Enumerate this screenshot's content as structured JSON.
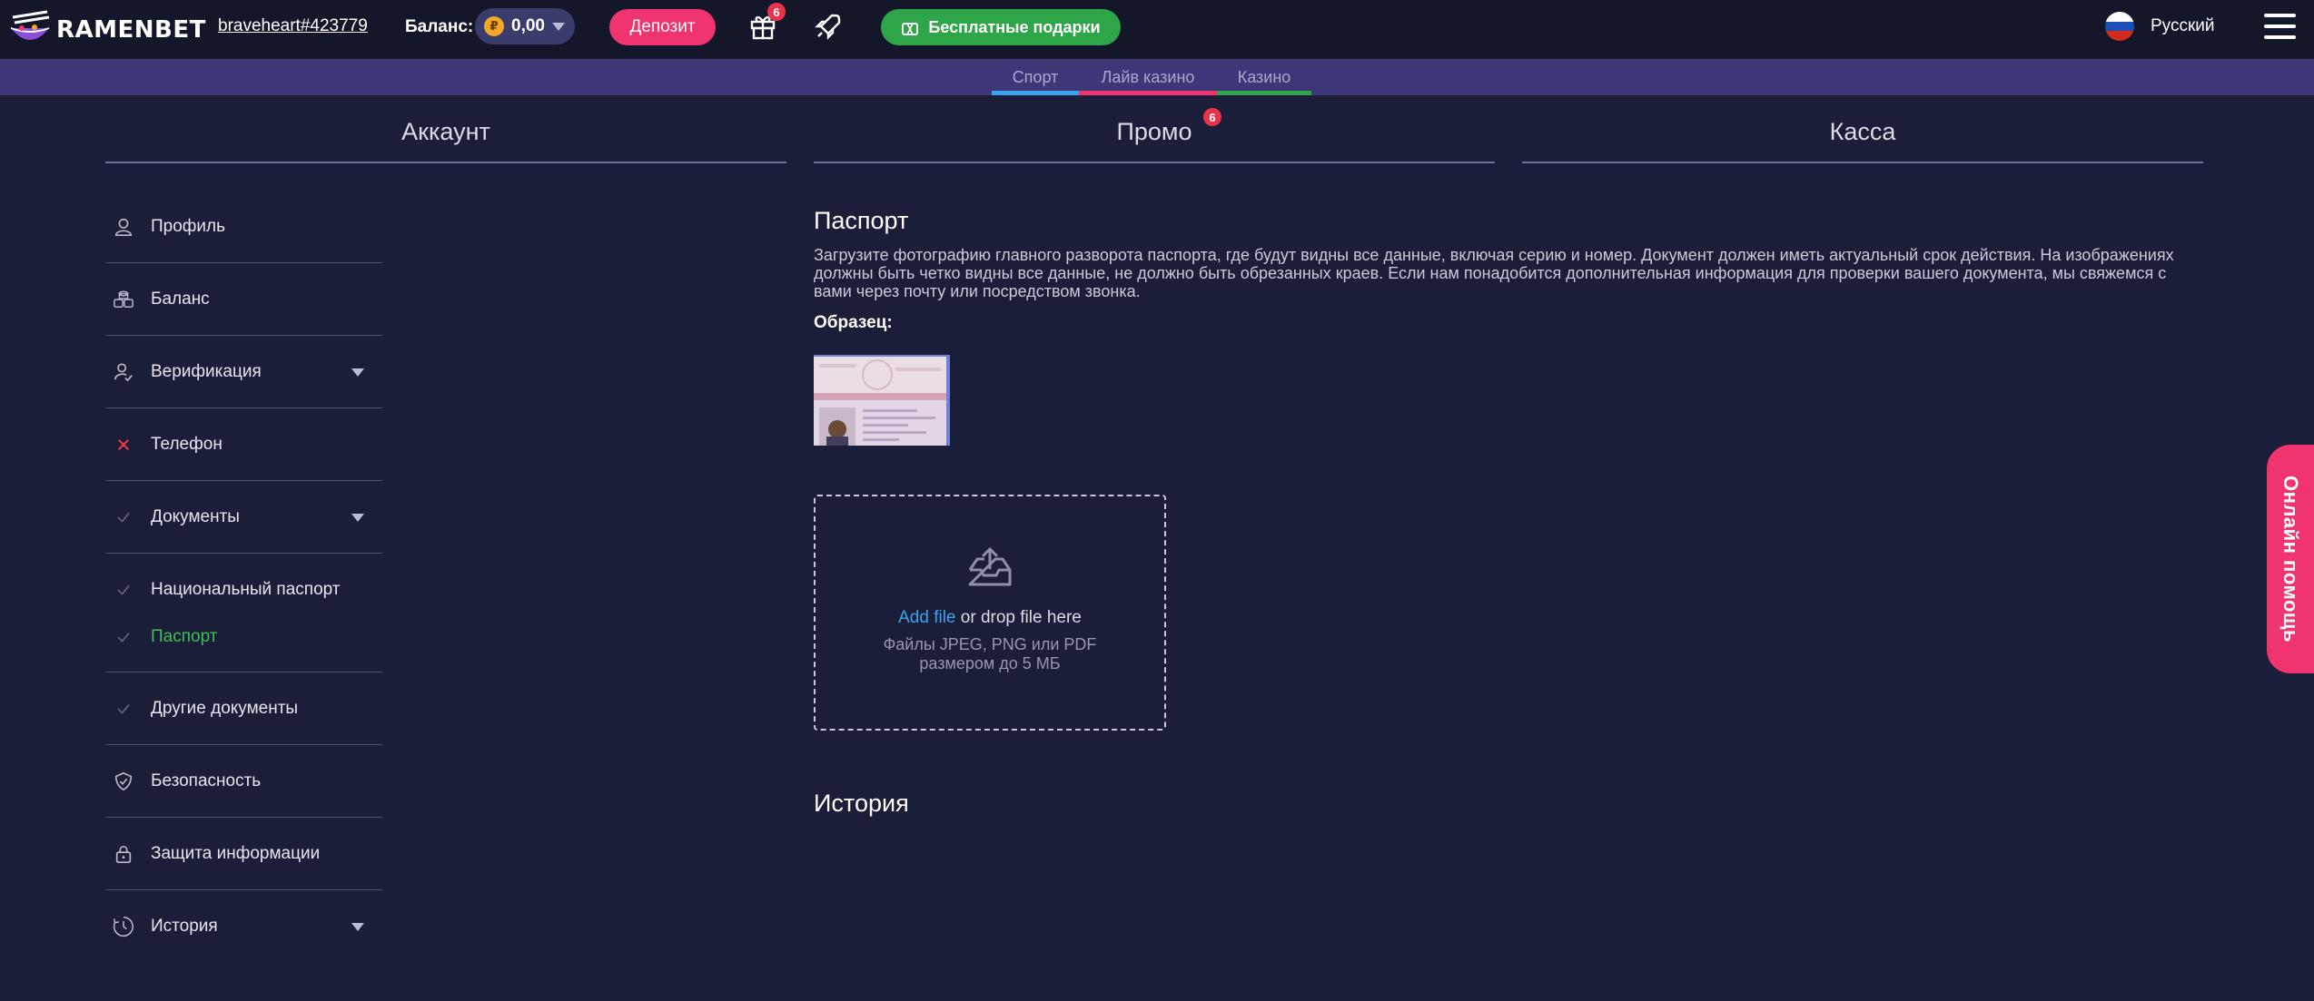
{
  "header": {
    "logo_text": "RAMENBET",
    "username": "braveheart#423779",
    "balance_label": "Баланс:",
    "balance_currency_symbol": "₽",
    "balance_value": "0,00",
    "deposit_label": "Депозит",
    "gift_badge_count": "6",
    "free_gifts_label": "Бесплатные подарки",
    "language_label": "Русский"
  },
  "subnav": {
    "tabs": [
      {
        "label": "Спорт",
        "color": "#3aa3f0"
      },
      {
        "label": "Лайв казино",
        "color": "#f0346f"
      },
      {
        "label": "Казино",
        "color": "#2fa54a"
      }
    ]
  },
  "sections": {
    "account": "Аккаунт",
    "promo": "Промо",
    "promo_badge_count": "6",
    "cashier": "Касса"
  },
  "sidebar": {
    "items": [
      {
        "label": "Профиль",
        "icon": "user-icon"
      },
      {
        "label": "Баланс",
        "icon": "coins-icon"
      },
      {
        "label": "Верификация",
        "icon": "user-check-icon"
      },
      {
        "label": "Телефон",
        "icon": "cross-icon"
      },
      {
        "label": "Документы",
        "icon": "check-icon"
      },
      {
        "label": "Национальный паспорт",
        "icon": "check-icon"
      },
      {
        "label": "Паспорт",
        "icon": "check-icon"
      },
      {
        "label": "Другие документы",
        "icon": "check-icon"
      },
      {
        "label": "Безопасность",
        "icon": "shield-icon"
      },
      {
        "label": "Защита информации",
        "icon": "lock-icon"
      },
      {
        "label": "История",
        "icon": "history-icon"
      }
    ]
  },
  "main": {
    "title": "Паспорт",
    "description": "Загрузите фотографию главного разворота паспорта, где будут видны все данные, включая серию и номер. Документ должен иметь актуальный срок действия. На изображениях должны быть четко видны все данные, не должно быть обрезанных краев. Если нам понадобится дополнительная информация для проверки вашего документа, мы свяжемся с вами через почту или посредством звонка.",
    "sample_label": "Образец:",
    "upload": {
      "add_file": "Add file",
      "drop_text": " or drop file here",
      "hint": "Файлы JPEG, PNG или PDF размером до 5 МБ"
    },
    "history_title": "История"
  },
  "help": {
    "label": "Онлайн помощь"
  },
  "colors": {
    "background": "#1b1e38",
    "topbar": "#141629",
    "accent_pink": "#f0346f",
    "accent_green": "#2fa54a",
    "link_blue": "#3aa3f0"
  }
}
